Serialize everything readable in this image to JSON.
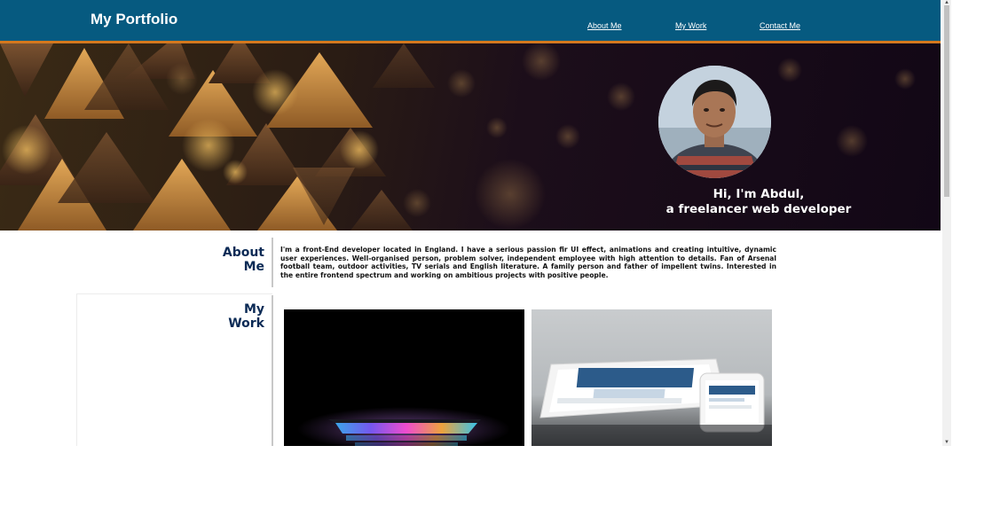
{
  "header": {
    "brand": "My Portfolio",
    "nav": [
      {
        "label": "About Me"
      },
      {
        "label": "My Work"
      },
      {
        "label": "Contact Me"
      }
    ]
  },
  "hero": {
    "greeting": "Hi, I'm Abdul,",
    "tagline": "a freelancer web developer"
  },
  "about": {
    "title_line1": "About",
    "title_line2": "Me",
    "body": "I'm a front-End developer located in England. I have a serious passion fir UI effect, animations and creating intuitive, dynamic user experiences. Well-organised person, problem solver, independent employee with high attention to details. Fan of Arsenal football team, outdoor activities, TV serials and English literature. A family person and father of impellent twins. Interested in the entire frontend spectrum and working on ambitious projects with positive people."
  },
  "work": {
    "title_line1": "My",
    "title_line2": "Work"
  },
  "colors": {
    "header_bg": "#065a80",
    "header_border": "#d4781e",
    "title_color": "#0b2a55"
  }
}
